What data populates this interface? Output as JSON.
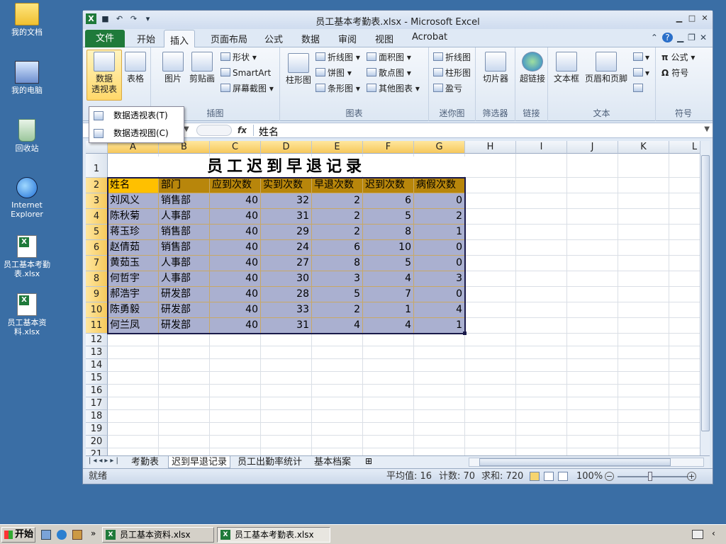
{
  "desktop": {
    "icons": [
      {
        "label": "我的文档"
      },
      {
        "label": "我的电脑"
      },
      {
        "label": "回收站"
      },
      {
        "label": "Internet Explorer"
      },
      {
        "label": "员工基本考勤表.xlsx"
      },
      {
        "label": "员工基本资料.xlsx"
      }
    ]
  },
  "window": {
    "title": "员工基本考勤表.xlsx - Microsoft Excel"
  },
  "ribbon": {
    "file_tab": "文件",
    "tabs": [
      "开始",
      "插入",
      "页面布局",
      "公式",
      "数据",
      "审阅",
      "视图",
      "Acrobat"
    ],
    "active_tab": "插入",
    "buttons": {
      "pivot": "数据透视表",
      "pivot_l1": "数据",
      "pivot_l2": "透视表",
      "table": "表格",
      "picture": "图片",
      "clipart": "剪贴画",
      "shapes": "形状",
      "smartart": "SmartArt",
      "screenshot": "屏幕截图",
      "column_chart": "柱形图",
      "line_chart": "折线图",
      "pie_chart": "饼图",
      "bar_chart": "条形图",
      "area_chart": "面积图",
      "scatter_chart": "散点图",
      "other_chart": "其他图表",
      "spark_line": "折线图",
      "spark_column": "柱形图",
      "spark_winloss": "盈亏",
      "slicer": "切片器",
      "hyperlink": "超链接",
      "textbox": "文本框",
      "header_footer": "页眉和页脚",
      "equation": "公式",
      "symbol": "符号"
    },
    "groups": {
      "illustrations": "插图",
      "charts": "图表",
      "sparklines": "迷你图",
      "filter": "筛选器",
      "links": "链接",
      "text": "文本",
      "symbols": "符号"
    }
  },
  "pivot_menu": {
    "items": [
      "数据透视表(T)",
      "数据透视图(C)"
    ]
  },
  "formula_bar": {
    "fx": "fx",
    "value": "姓名"
  },
  "sheet": {
    "columns": [
      "A",
      "B",
      "C",
      "D",
      "E",
      "F",
      "G",
      "H",
      "I",
      "J",
      "K",
      "L"
    ],
    "title": "员工迟到早退记录",
    "headers": [
      "姓名",
      "部门",
      "应到次数",
      "实到次数",
      "早退次数",
      "迟到次数",
      "病假次数"
    ],
    "rows": [
      [
        "刘风义",
        "销售部",
        "40",
        "32",
        "2",
        "6",
        "0"
      ],
      [
        "陈秋菊",
        "人事部",
        "40",
        "31",
        "2",
        "5",
        "2"
      ],
      [
        "蒋玉珍",
        "销售部",
        "40",
        "29",
        "2",
        "8",
        "1"
      ],
      [
        "赵倩茹",
        "销售部",
        "40",
        "24",
        "6",
        "10",
        "0"
      ],
      [
        "黄茹玉",
        "人事部",
        "40",
        "27",
        "8",
        "5",
        "0"
      ],
      [
        "何哲宇",
        "人事部",
        "40",
        "30",
        "3",
        "4",
        "3"
      ],
      [
        "郝浩宇",
        "研发部",
        "40",
        "28",
        "5",
        "7",
        "0"
      ],
      [
        "陈勇毅",
        "研发部",
        "40",
        "33",
        "2",
        "1",
        "4"
      ],
      [
        "何兰凤",
        "研发部",
        "40",
        "31",
        "4",
        "4",
        "1"
      ]
    ],
    "row_numbers": [
      "1",
      "2",
      "3",
      "4",
      "5",
      "6",
      "7",
      "8",
      "9",
      "10",
      "11",
      "12",
      "13",
      "14",
      "15",
      "16",
      "17",
      "18",
      "19",
      "20",
      "21"
    ]
  },
  "sheet_tabs": [
    "考勤表",
    "迟到早退记录",
    "员工出勤率统计",
    "基本档案"
  ],
  "active_sheet": "迟到早退记录",
  "status": {
    "ready": "就绪",
    "average": "平均值: 16",
    "count": "计数: 70",
    "sum": "求和: 720",
    "zoom": "100%"
  },
  "taskbar": {
    "start": "开始",
    "tasks": [
      "员工基本资料.xlsx",
      "员工基本考勤表.xlsx"
    ]
  },
  "colors": {
    "header_fill": "#b8860b",
    "selected_header": "#ffc000",
    "data_fill": "#aab0d0",
    "excel_green": "#1f7a3a"
  }
}
